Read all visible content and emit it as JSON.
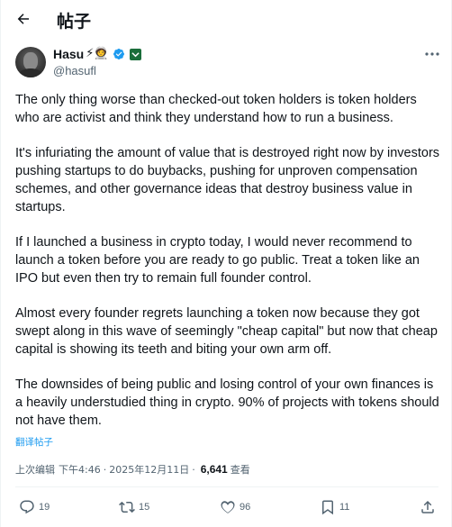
{
  "header": {
    "title": "帖子"
  },
  "author": {
    "display_name": "Hasu",
    "emojis": "⚡🧑‍🚀",
    "handle": "@hasufl"
  },
  "tweet": {
    "paragraphs": [
      "The only thing worse than checked-out token holders is token holders who are activist and think they understand how to run a business.",
      "It's infuriating the amount of value that is destroyed right now by investors pushing startups to do buybacks, pushing for unproven compensation schemes, and other governance ideas that destroy business value in startups.",
      "If I launched a business in crypto today, I would never recommend to launch a token before you are ready to go public. Treat a token like an IPO but even then try to remain full founder control.",
      "Almost every founder regrets launching a token now because they got swept along in this wave of seemingly \"cheap capital\" but now that cheap capital is showing its teeth and biting your own arm off.",
      "The downsides of being public and losing control of your own finances is a heavily understudied thing in crypto. 90% of projects with tokens should not have them."
    ],
    "translate_label": "翻译帖子"
  },
  "meta": {
    "edited_label": "上次编辑",
    "time": "下午4:46",
    "separator": "·",
    "date": "2025年12月11日",
    "views_count": "6,641",
    "views_label": "查看"
  },
  "actions": {
    "replies": "19",
    "reposts": "15",
    "likes": "96",
    "bookmarks": "11"
  },
  "colors": {
    "accent": "#1d9bf0",
    "secondary_text": "#536471",
    "primary_text": "#0f1419",
    "affiliate_badge": "#1b6e3b"
  },
  "icons": {
    "back": "arrow-left-icon",
    "more": "more-horizontal-icon",
    "verified": "verified-badge-icon",
    "affiliate": "affiliate-badge-icon",
    "reply": "reply-icon",
    "repost": "repost-icon",
    "like": "heart-icon",
    "bookmark": "bookmark-icon",
    "share": "share-icon"
  }
}
